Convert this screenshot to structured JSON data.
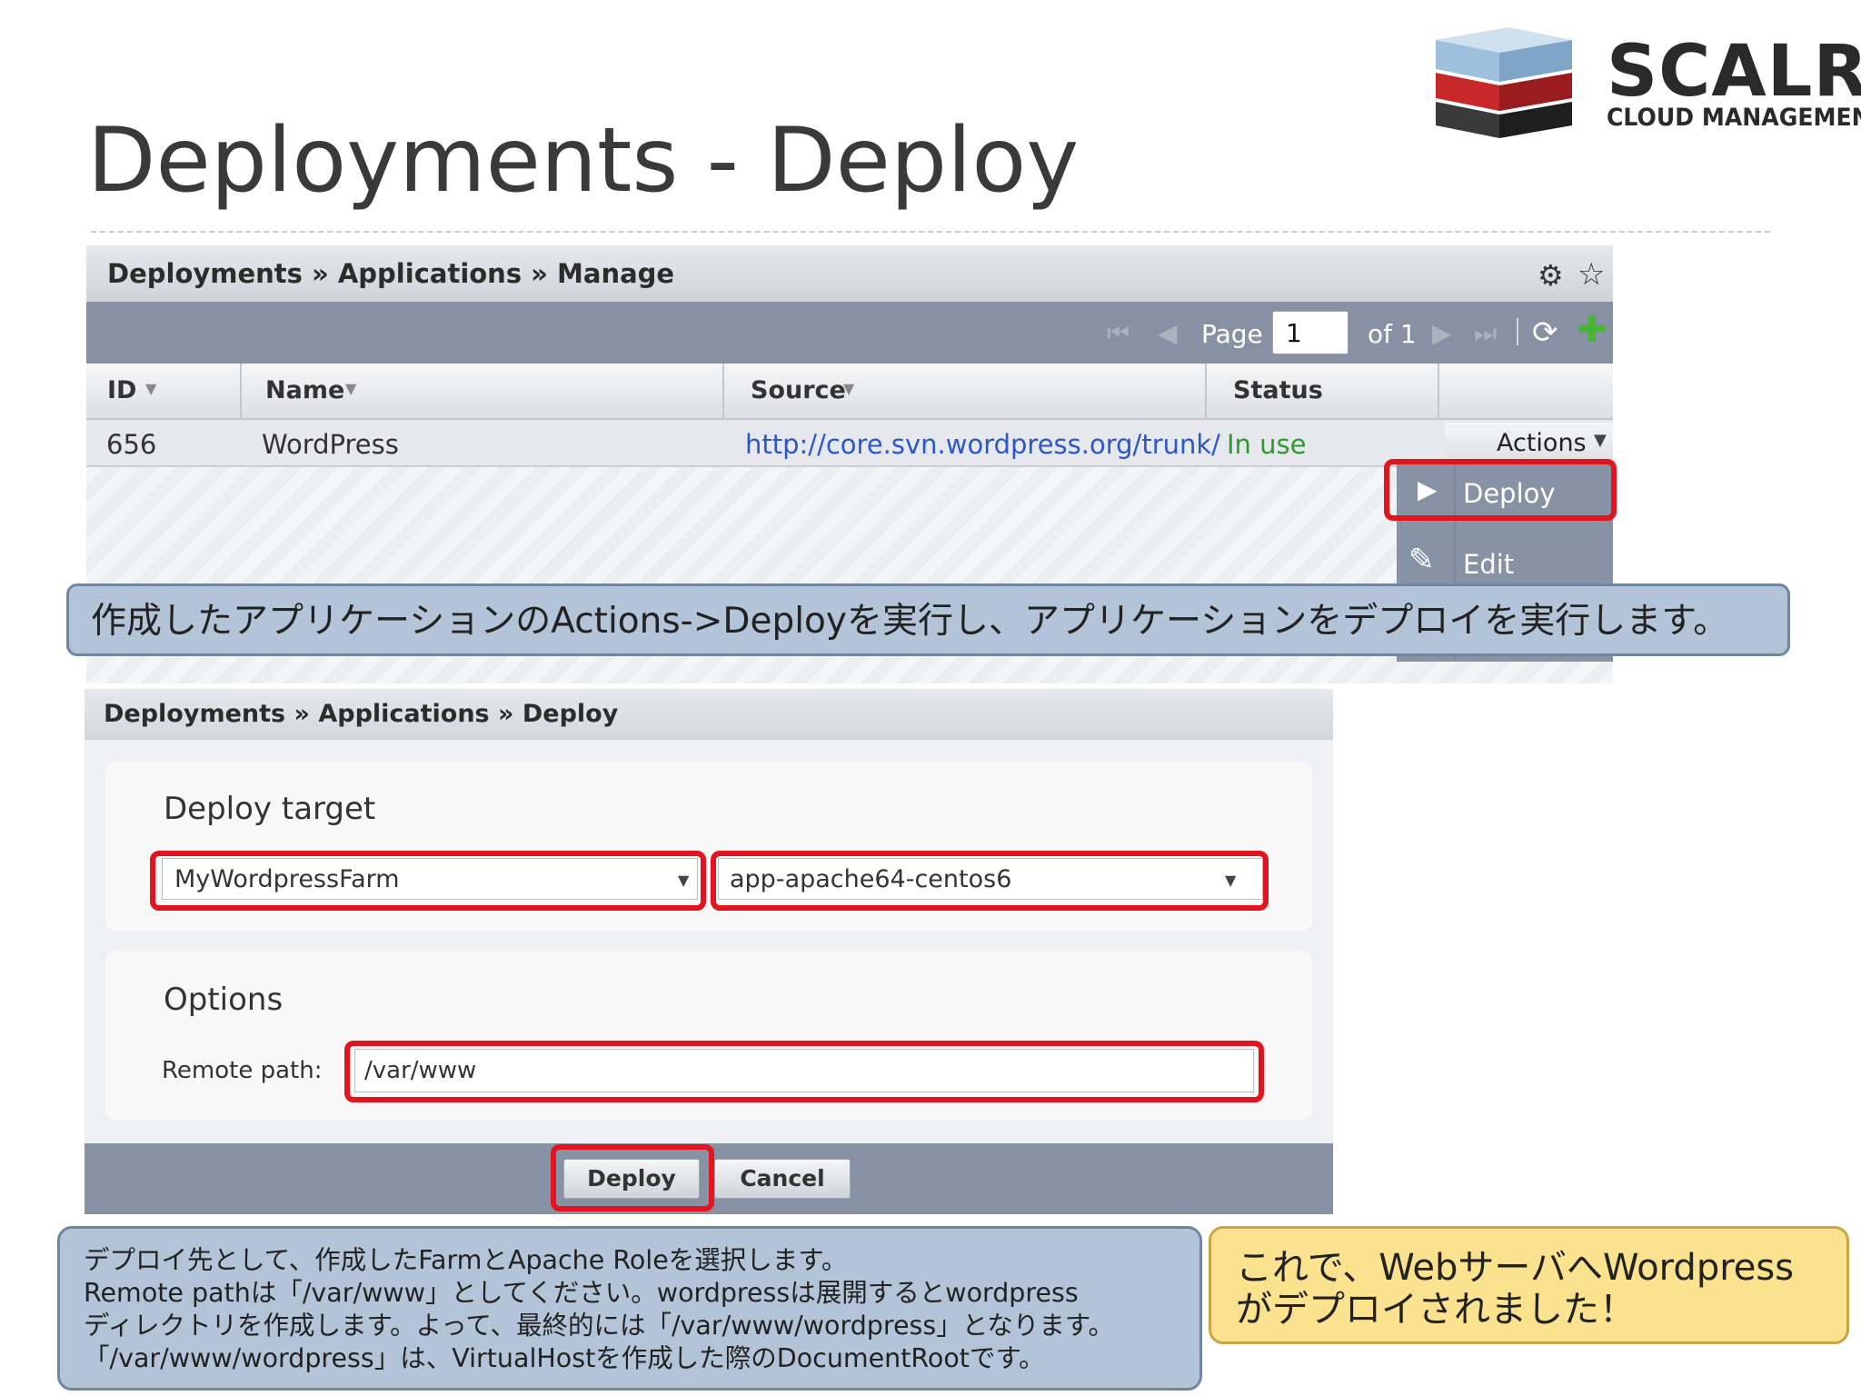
{
  "slide": {
    "title": "Deployments - Deploy",
    "logo": {
      "name": "SCALR",
      "tagline": "CLOUD MANAGEMENT"
    }
  },
  "manage_panel": {
    "breadcrumb": "Deployments » Applications » Manage",
    "toolbar": {
      "page_label": "Page",
      "page_value": "1",
      "of_label": "of 1"
    },
    "columns": [
      "ID",
      "Name",
      "Source",
      "Status"
    ],
    "row": {
      "id": "656",
      "name": "WordPress",
      "source": "http://core.svn.wordpress.org/trunk/",
      "status": "In use",
      "actions_label": "Actions"
    },
    "actions_menu": [
      {
        "label": "Deploy",
        "icon": "play-icon",
        "highlighted": true
      },
      {
        "label": "Edit",
        "icon": "pencil-icon",
        "highlighted": false
      }
    ]
  },
  "callout_top": "作成したアプリケーションのActions->Deployを実行し、アプリケーションをデプロイを実行します。",
  "deploy_panel": {
    "breadcrumb": "Deployments » Applications » Deploy",
    "target": {
      "title": "Deploy target",
      "farm": "MyWordpressFarm",
      "role": "app-apache64-centos6"
    },
    "options": {
      "title": "Options",
      "remote_path_label": "Remote path:",
      "remote_path_value": "/var/www"
    },
    "buttons": {
      "deploy": "Deploy",
      "cancel": "Cancel"
    }
  },
  "callout_bottom": [
    "デプロイ先として、作成したFarmとApache Roleを選択します。",
    "Remote pathは「/var/www」としてください。wordpressは展開するとwordpress",
    "ディレクトリを作成します。よって、最終的には「/var/www/wordpress」となります。",
    "「/var/www/wordpress」は、VirtualHostを作成した際のDocumentRootです。"
  ],
  "callout_result": [
    "これで、WebサーバへWordpress",
    "がデプロイされました！"
  ],
  "colors": {
    "highlight": "#e4141e",
    "toolbar": "#8792a4",
    "callout_blue": "#b3c4d8",
    "callout_yellow": "#fbe28f",
    "link": "#2b57c7",
    "status_ok": "#2c9a2c"
  }
}
